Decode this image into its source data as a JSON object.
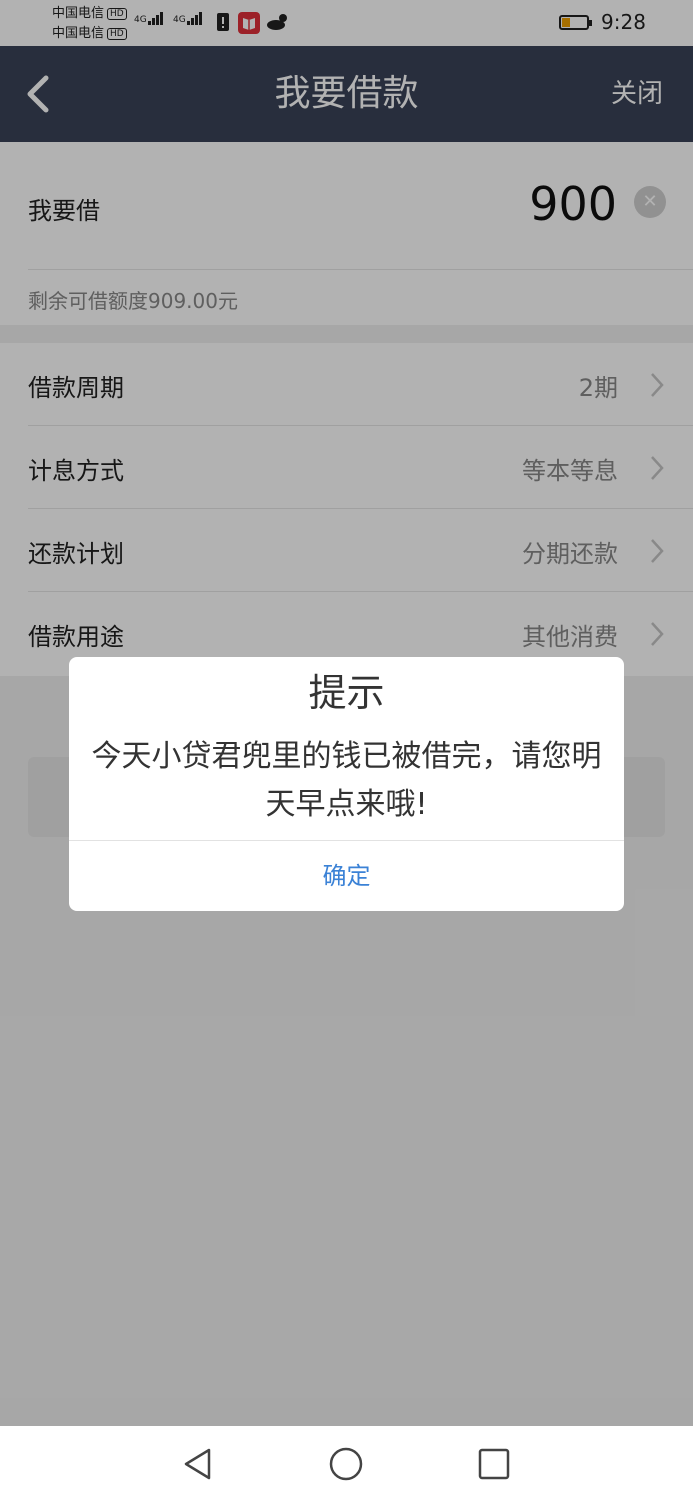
{
  "status_bar": {
    "carrier_1": "中国电信",
    "carrier_2": "中国电信",
    "hd_badge": "HD",
    "network_1": "4G",
    "network_2": "4G",
    "time": "9:28",
    "battery_color": "#f0a000"
  },
  "nav": {
    "title": "我要借款",
    "close_label": "关闭",
    "back_icon": "chevron-left-icon",
    "bg_color": "#3a4358"
  },
  "amount": {
    "label": "我要借",
    "value": "900",
    "remaining_text": "剩余可借额度909.00元"
  },
  "options": [
    {
      "label": "借款周期",
      "value": "2期"
    },
    {
      "label": "计息方式",
      "value": "等本等息"
    },
    {
      "label": "还款计划",
      "value": "分期还款"
    },
    {
      "label": "借款用途",
      "value": "其他消费"
    }
  ],
  "dialog": {
    "title": "提示",
    "message": "今天小贷君兜里的钱已被借完，请您明天早点来哦!",
    "confirm_label": "确定",
    "confirm_color": "#3b82d6"
  },
  "system_nav": {
    "back_icon": "triangle-back-icon",
    "home_icon": "circle-home-icon",
    "recents_icon": "square-recents-icon"
  }
}
